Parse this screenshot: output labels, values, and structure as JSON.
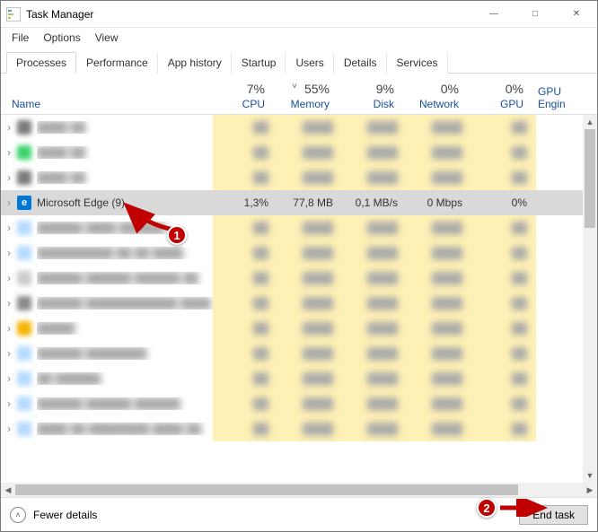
{
  "window": {
    "title": "Task Manager",
    "buttons": {
      "min": "—",
      "max": "□",
      "close": "✕"
    }
  },
  "menu": {
    "file": "File",
    "options": "Options",
    "view": "View"
  },
  "tabs": [
    "Processes",
    "Performance",
    "App history",
    "Startup",
    "Users",
    "Details",
    "Services"
  ],
  "active_tab": 0,
  "columns": {
    "name": "Name",
    "cpu": {
      "pct": "7%",
      "label": "CPU"
    },
    "memory": {
      "pct": "55%",
      "label": "Memory",
      "sorted": true
    },
    "disk": {
      "pct": "9%",
      "label": "Disk"
    },
    "network": {
      "pct": "0%",
      "label": "Network"
    },
    "gpu": {
      "pct": "0%",
      "label": "GPU"
    },
    "gpu_engine": "GPU Engin"
  },
  "selected_row": {
    "name": "Microsoft Edge (9)",
    "cpu": "1,3%",
    "memory": "77,8 MB",
    "disk": "0,1 MB/s",
    "network": "0 Mbps",
    "gpu": "0%"
  },
  "blur_rows": [
    {
      "name": "████ ██",
      "icon": "#7a7a7a"
    },
    {
      "name": "████ ██",
      "icon": "#3bd46b"
    },
    {
      "name": "████ ██",
      "icon": "#7a7a7a"
    },
    {
      "name": "██████ ████ ██████",
      "icon": "#b6dbff"
    },
    {
      "name": "██████████ ██ ██ ████",
      "icon": "#b6dbff"
    },
    {
      "name": "██████ ██████ ██████ ██",
      "icon": "#cccccc"
    },
    {
      "name": "██████ ████████████ ████",
      "icon": "#8a8a8a"
    },
    {
      "name": "█████",
      "icon": "#f4b400"
    },
    {
      "name": "██████ ████████",
      "icon": "#b6dbff"
    },
    {
      "name": "██ ██████",
      "icon": "#b6dbff"
    },
    {
      "name": "██████ ██████ ██████",
      "icon": "#b6dbff"
    },
    {
      "name": "████ ██ ████████ ████ ██",
      "icon": "#b6dbff"
    }
  ],
  "footer": {
    "fewer": "Fewer details",
    "endtask": "End task"
  },
  "annotations": {
    "badge1": "1",
    "badge2": "2"
  }
}
